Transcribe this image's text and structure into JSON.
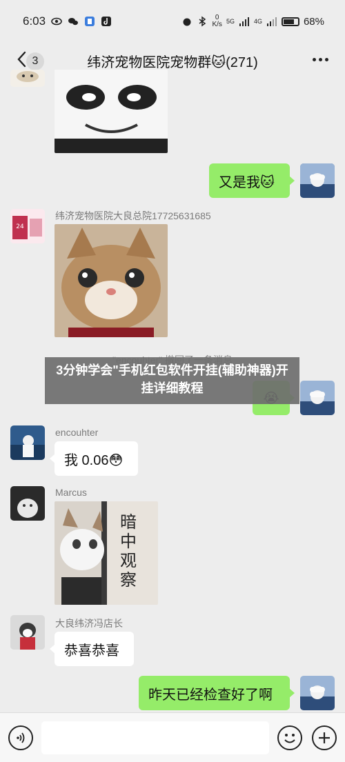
{
  "status_bar": {
    "time": "6:03",
    "net_speed_value": "0",
    "net_speed_unit": "K/s",
    "sim1": "5G",
    "sim2": "4G",
    "battery": "68%"
  },
  "header": {
    "unread_count": "3",
    "title": "纬济宠物医院宠物群🐱(271)"
  },
  "messages": [
    {
      "side": "right",
      "text": "又是我🐱"
    },
    {
      "side": "left",
      "sender": "纬济宠物医院大良总院17725631685",
      "type": "sticker",
      "avatar_text": "24小时医院"
    },
    {
      "type": "system",
      "text": "\"encouhter\" 撤回了一条消息"
    },
    {
      "side": "right",
      "text": "😭"
    },
    {
      "side": "left",
      "sender": "encouhter",
      "text": "我 0.06😳"
    },
    {
      "side": "left",
      "sender": "Marcus",
      "type": "sticker",
      "sticker_text": "暗中观察"
    },
    {
      "side": "left",
      "sender": "大良纬济冯店长",
      "text": "恭喜恭喜"
    },
    {
      "side": "right",
      "text": "昨天已经检查好了啊"
    }
  ],
  "overlay": {
    "text": "3分钟学会\"手机红包软件开挂(辅助神器)开挂详细教程"
  },
  "colors": {
    "bubble_green": "#95ec69",
    "background": "#ededed"
  }
}
